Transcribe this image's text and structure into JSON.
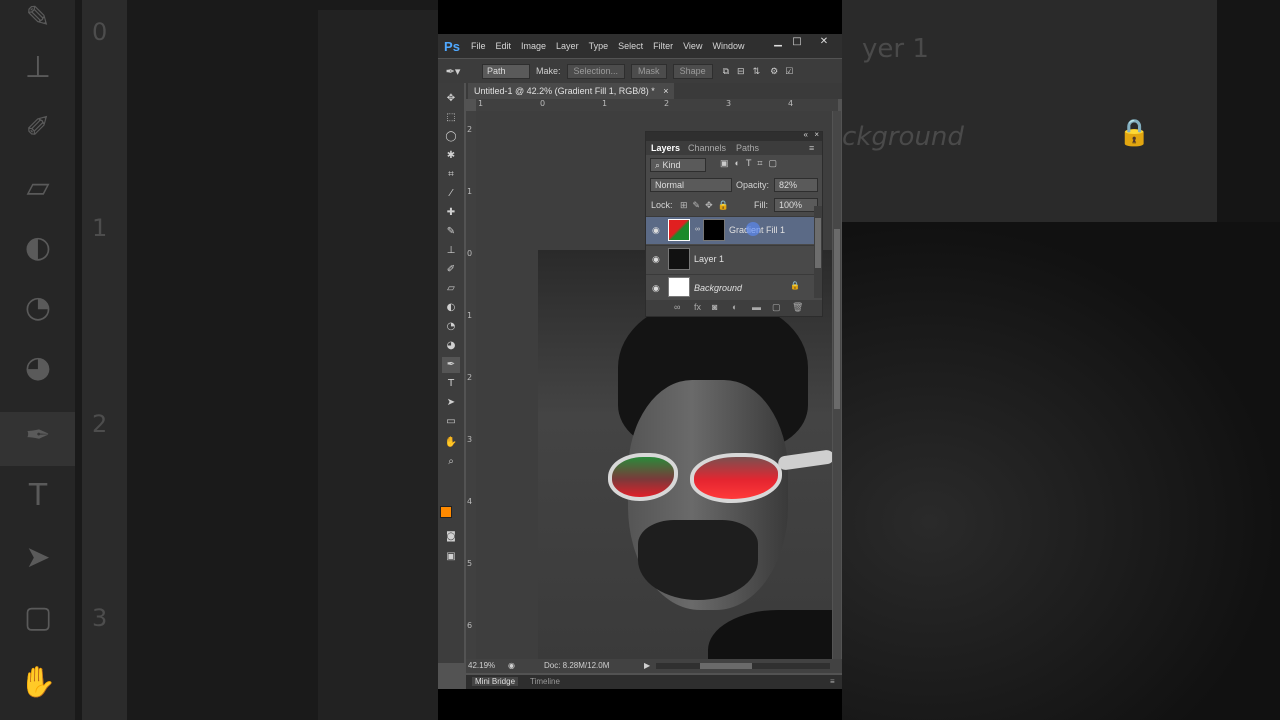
{
  "app": {
    "logo": "Ps"
  },
  "menu": [
    "File",
    "Edit",
    "Image",
    "Layer",
    "Type",
    "Select",
    "Filter",
    "View",
    "Window"
  ],
  "window_controls": {
    "minimize": "▁",
    "maximize": "□",
    "close": "✕"
  },
  "options_bar": {
    "mode": "Path",
    "make_label": "Make:",
    "selection_button": "Selection...",
    "mask_button": "Mask",
    "shape_button": "Shape"
  },
  "document": {
    "tab_title": "Untitled-1 @ 42.2% (Gradient Fill 1, RGB/8) *",
    "close_glyph": "×"
  },
  "rulers": {
    "h_ticks": [
      "1",
      "0",
      "1",
      "2",
      "3",
      "4"
    ],
    "v_ticks": [
      "2",
      "1",
      "0",
      "1",
      "2",
      "3",
      "4",
      "5",
      "6"
    ]
  },
  "status": {
    "zoom": "42.19%",
    "doc": "Doc: 8.28M/12.0M"
  },
  "bottom_tabs": [
    "Mini Bridge",
    "Timeline"
  ],
  "colors": {
    "foreground": "#ff8a00",
    "background": "#ffffff"
  },
  "layers_panel": {
    "tabs": [
      "Layers",
      "Channels",
      "Paths"
    ],
    "filter_kind": "Kind",
    "blend_mode": "Normal",
    "opacity_label": "Opacity:",
    "opacity_value": "82%",
    "lock_label": "Lock:",
    "fill_label": "Fill:",
    "fill_value": "100%",
    "layers": [
      {
        "name": "Gradient Fill 1",
        "selected": true
      },
      {
        "name": "Layer 1",
        "selected": false
      },
      {
        "name": "Background",
        "selected": false
      }
    ]
  },
  "background_left": {
    "ruler_numbers": [
      "0",
      "1",
      "2",
      "3"
    ]
  },
  "background_right": {
    "layer_ghost": "yer 1",
    "background_ghost": "ckground"
  }
}
